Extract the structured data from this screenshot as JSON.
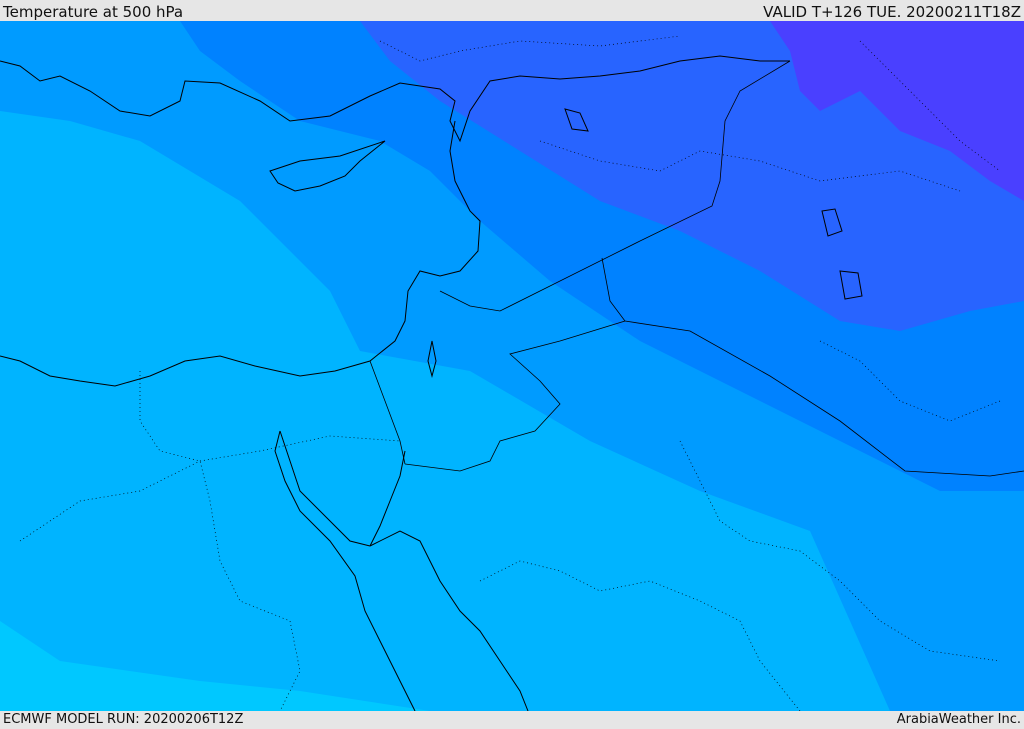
{
  "header": {
    "title": "Temperature at 500 hPa",
    "valid": "VALID T+126 TUE. 20200211T18Z"
  },
  "footer": {
    "model_run": "ECMWF MODEL RUN: 20200206T12Z",
    "credit": "ArabiaWeather Inc."
  },
  "palette": {
    "band_1": "#00c8ff",
    "band_2": "#00b4ff",
    "band_3": "#009bff",
    "band_4": "#0082ff",
    "band_5": "#2864ff",
    "band_6": "#4a40ff",
    "coast": "#000000"
  }
}
